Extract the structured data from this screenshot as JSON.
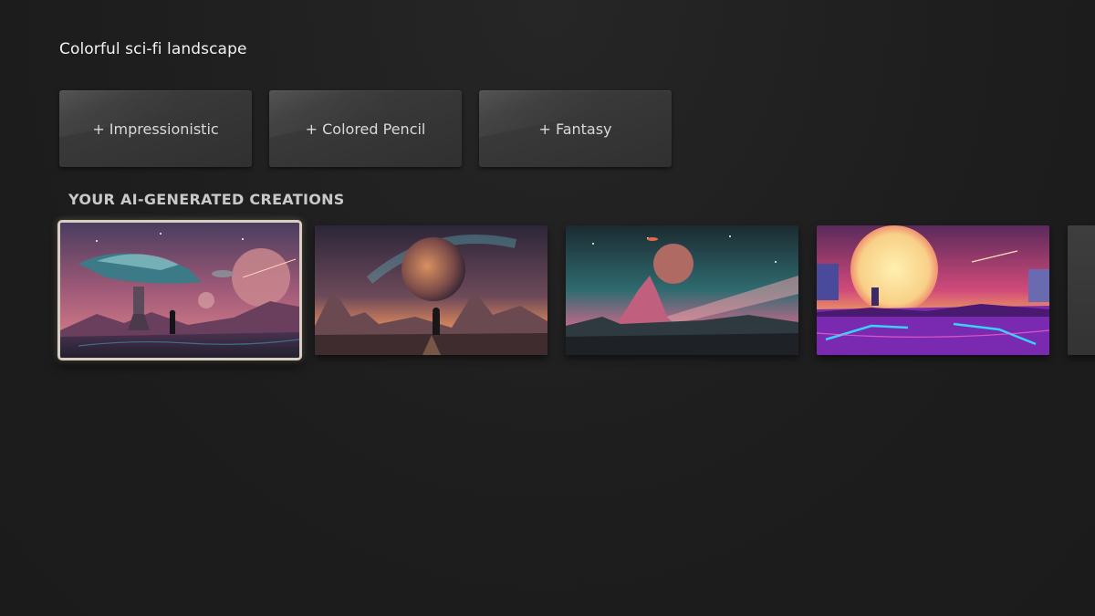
{
  "prompt": {
    "text": "Colorful sci-fi landscape"
  },
  "style_suggestions": [
    {
      "label": "+ Impressionistic"
    },
    {
      "label": "+ Colored Pencil"
    },
    {
      "label": "+ Fantasy"
    }
  ],
  "creations": {
    "title": "YOUR AI-GENERATED CREATIONS",
    "focused_index": 0
  },
  "colors": {
    "background": "#1e1e1e",
    "focus_border": "#d8cfc0",
    "button_text": "#d9d9d9"
  }
}
